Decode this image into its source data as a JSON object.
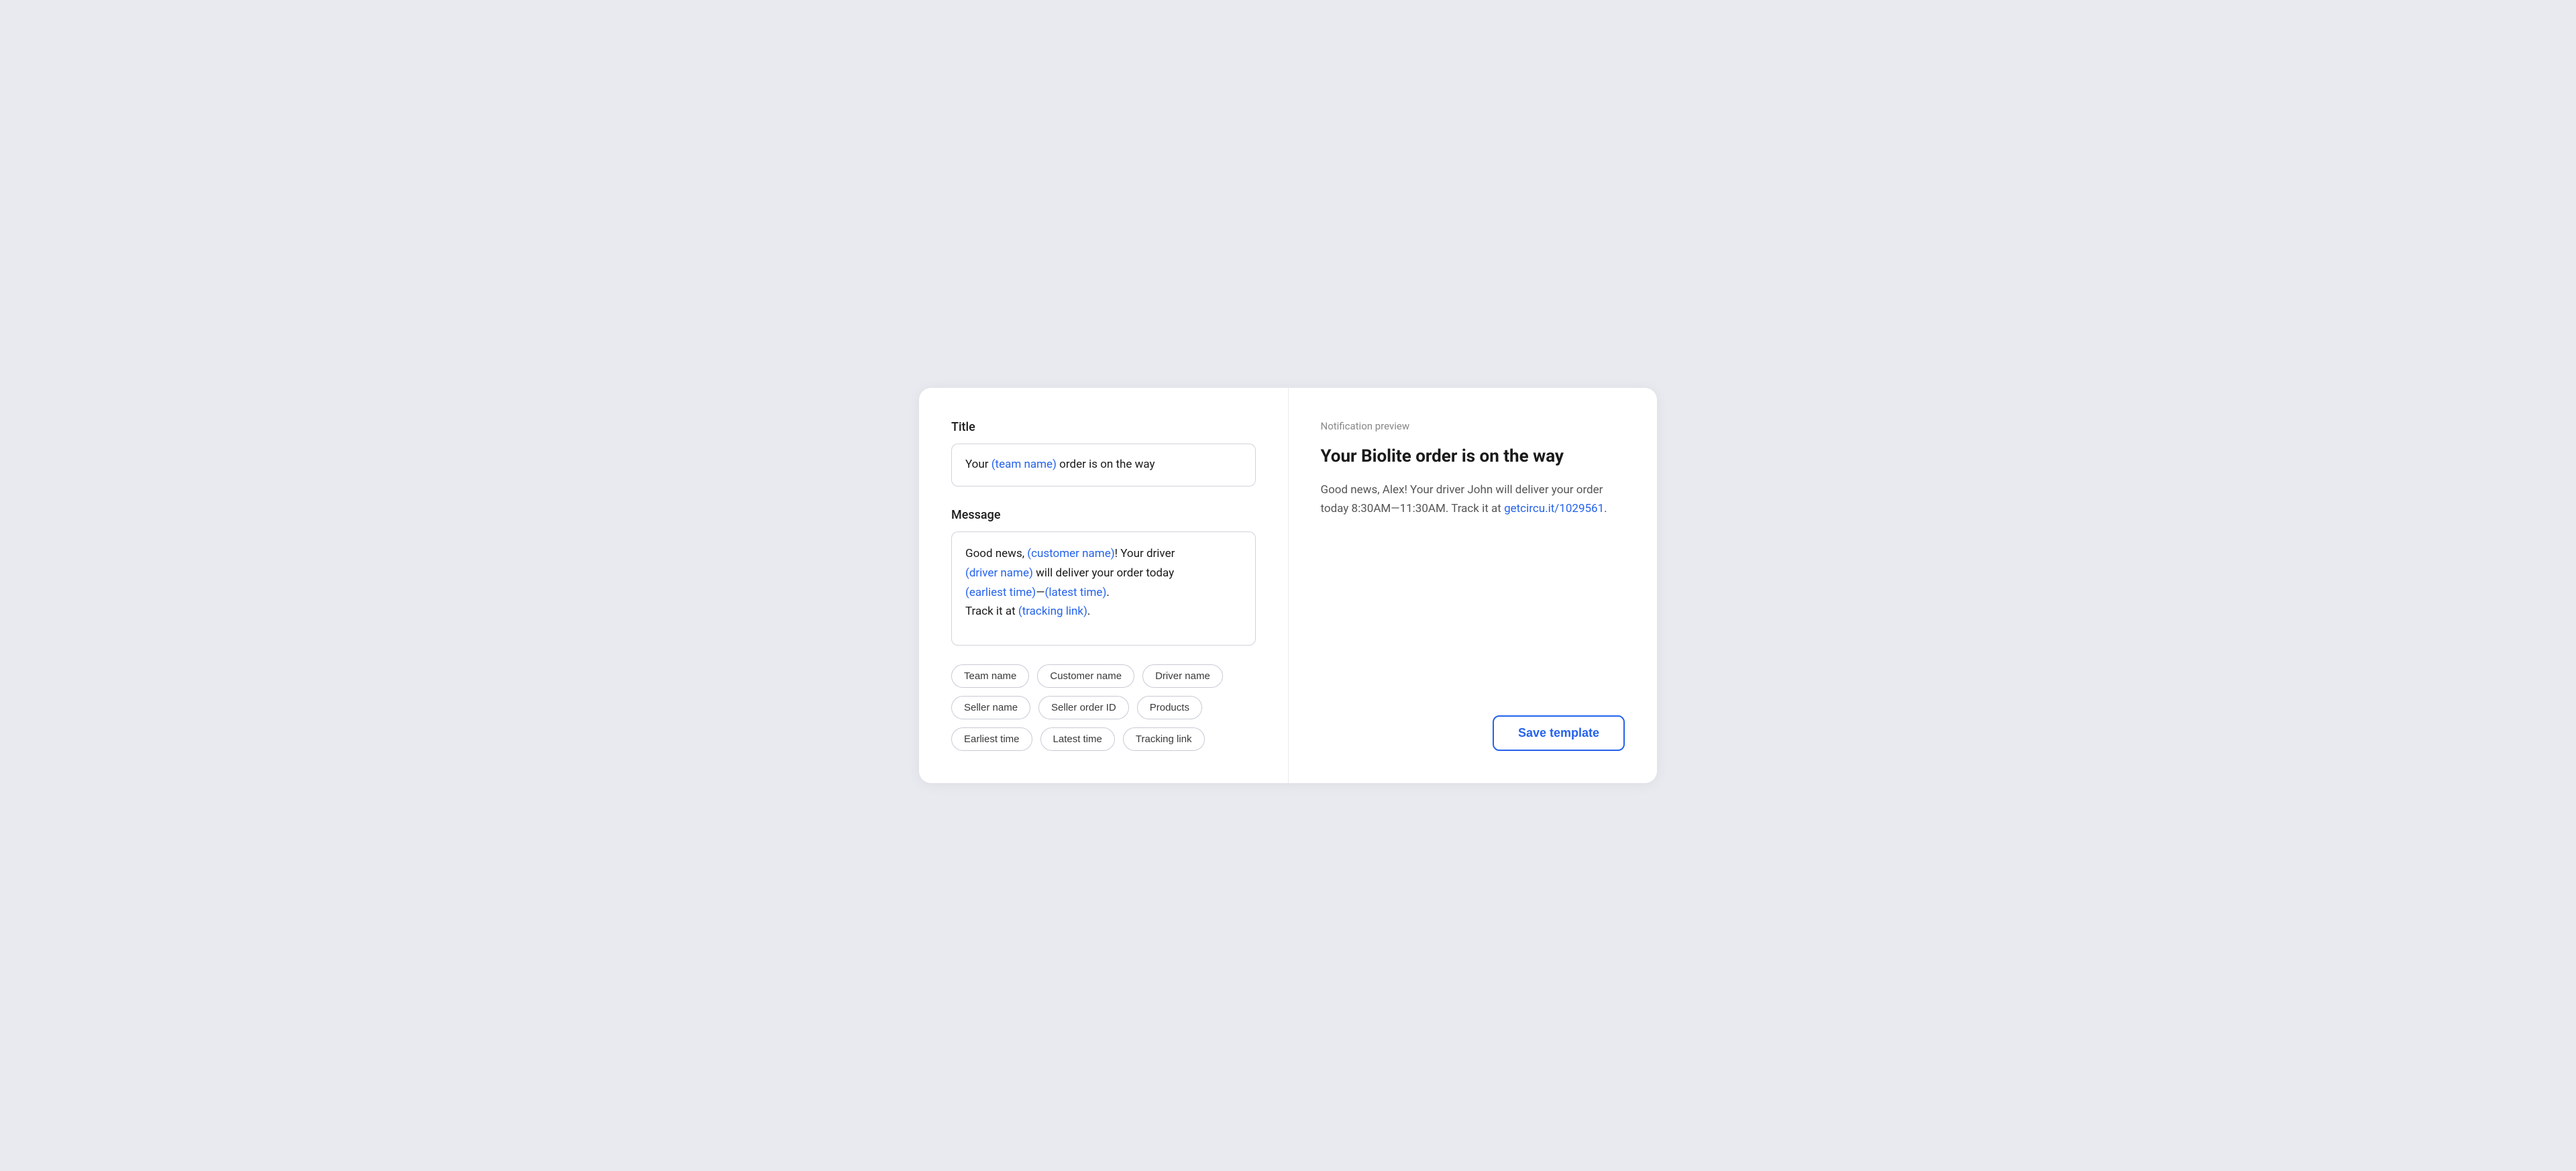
{
  "left": {
    "title_label": "Title",
    "title_value_plain": "Your ",
    "title_token": "(team name)",
    "title_value_suffix": " order is on the way",
    "message_label": "Message",
    "message_line1_plain": "Good news, ",
    "message_line1_token": "(customer name)",
    "message_line1_suffix": "! Your driver",
    "message_line2_token": "(driver name)",
    "message_line2_suffix": " will deliver your order today",
    "message_line3_token1": "(earliest time)",
    "message_line3_dash": "—",
    "message_line3_token2": "(latest time)",
    "message_line3_period": ".",
    "message_line4_plain": "Track it at ",
    "message_line4_token": "(tracking link)",
    "message_line4_period": ".",
    "tags": [
      "Team name",
      "Customer name",
      "Driver name",
      "Seller name",
      "Seller order ID",
      "Products",
      "Earliest time",
      "Latest time",
      "Tracking link"
    ]
  },
  "right": {
    "preview_label": "Notification preview",
    "preview_title": "Your Biolite order is on the way",
    "preview_body_1": "Good news, Alex! Your driver John will deliver your order today 8:30AM",
    "preview_body_dash": "—",
    "preview_body_2": "11:30AM. Track it at ",
    "preview_link_text": "getcircu.it/1029561",
    "preview_link_url": "#",
    "preview_body_end": ".",
    "save_label": "Save template"
  },
  "colors": {
    "accent": "#2563eb"
  }
}
